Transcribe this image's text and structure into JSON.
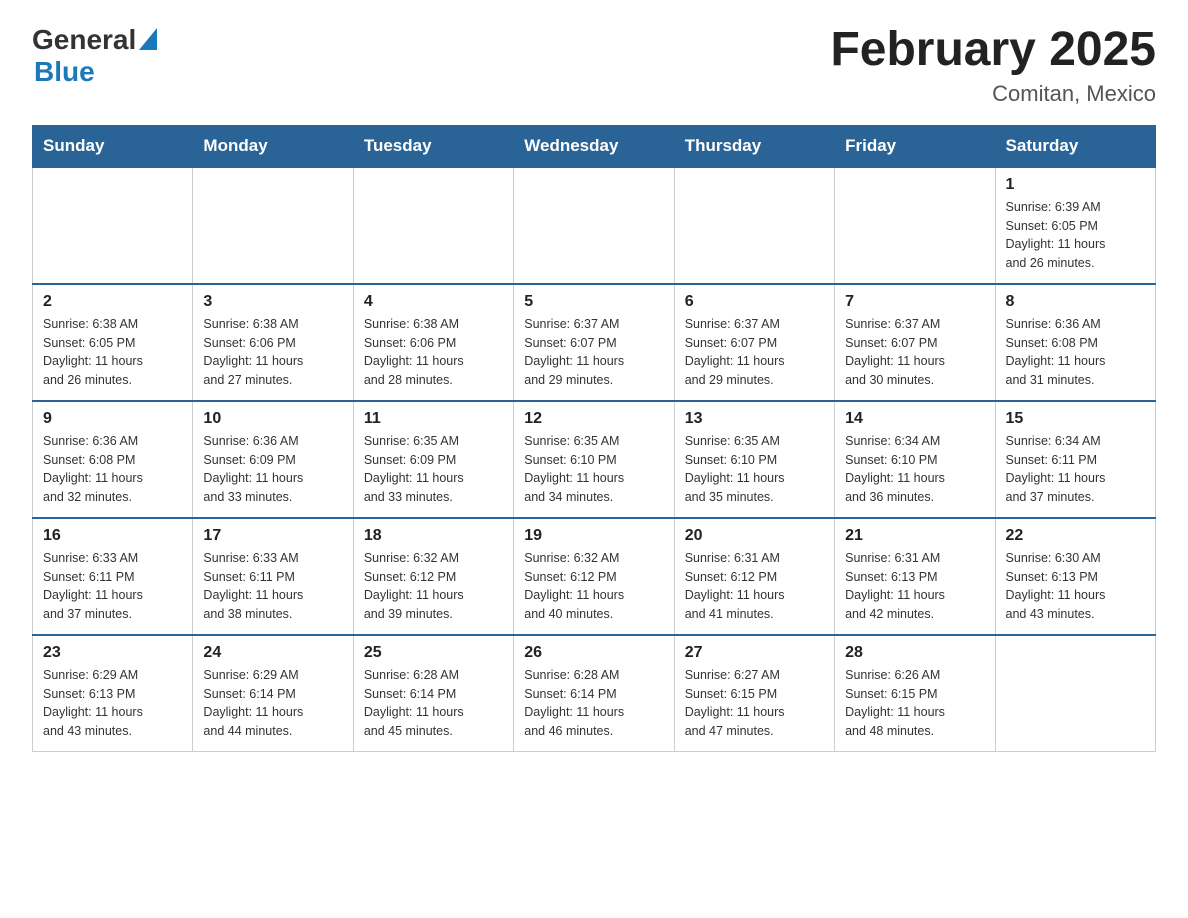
{
  "header": {
    "logo": {
      "general": "General",
      "blue": "Blue",
      "triangle_color": "#1a7ab8"
    },
    "title": "February 2025",
    "location": "Comitan, Mexico"
  },
  "calendar": {
    "weekdays": [
      "Sunday",
      "Monday",
      "Tuesday",
      "Wednesday",
      "Thursday",
      "Friday",
      "Saturday"
    ],
    "weeks": [
      [
        {
          "day": "",
          "info": ""
        },
        {
          "day": "",
          "info": ""
        },
        {
          "day": "",
          "info": ""
        },
        {
          "day": "",
          "info": ""
        },
        {
          "day": "",
          "info": ""
        },
        {
          "day": "",
          "info": ""
        },
        {
          "day": "1",
          "info": "Sunrise: 6:39 AM\nSunset: 6:05 PM\nDaylight: 11 hours\nand 26 minutes."
        }
      ],
      [
        {
          "day": "2",
          "info": "Sunrise: 6:38 AM\nSunset: 6:05 PM\nDaylight: 11 hours\nand 26 minutes."
        },
        {
          "day": "3",
          "info": "Sunrise: 6:38 AM\nSunset: 6:06 PM\nDaylight: 11 hours\nand 27 minutes."
        },
        {
          "day": "4",
          "info": "Sunrise: 6:38 AM\nSunset: 6:06 PM\nDaylight: 11 hours\nand 28 minutes."
        },
        {
          "day": "5",
          "info": "Sunrise: 6:37 AM\nSunset: 6:07 PM\nDaylight: 11 hours\nand 29 minutes."
        },
        {
          "day": "6",
          "info": "Sunrise: 6:37 AM\nSunset: 6:07 PM\nDaylight: 11 hours\nand 29 minutes."
        },
        {
          "day": "7",
          "info": "Sunrise: 6:37 AM\nSunset: 6:07 PM\nDaylight: 11 hours\nand 30 minutes."
        },
        {
          "day": "8",
          "info": "Sunrise: 6:36 AM\nSunset: 6:08 PM\nDaylight: 11 hours\nand 31 minutes."
        }
      ],
      [
        {
          "day": "9",
          "info": "Sunrise: 6:36 AM\nSunset: 6:08 PM\nDaylight: 11 hours\nand 32 minutes."
        },
        {
          "day": "10",
          "info": "Sunrise: 6:36 AM\nSunset: 6:09 PM\nDaylight: 11 hours\nand 33 minutes."
        },
        {
          "day": "11",
          "info": "Sunrise: 6:35 AM\nSunset: 6:09 PM\nDaylight: 11 hours\nand 33 minutes."
        },
        {
          "day": "12",
          "info": "Sunrise: 6:35 AM\nSunset: 6:10 PM\nDaylight: 11 hours\nand 34 minutes."
        },
        {
          "day": "13",
          "info": "Sunrise: 6:35 AM\nSunset: 6:10 PM\nDaylight: 11 hours\nand 35 minutes."
        },
        {
          "day": "14",
          "info": "Sunrise: 6:34 AM\nSunset: 6:10 PM\nDaylight: 11 hours\nand 36 minutes."
        },
        {
          "day": "15",
          "info": "Sunrise: 6:34 AM\nSunset: 6:11 PM\nDaylight: 11 hours\nand 37 minutes."
        }
      ],
      [
        {
          "day": "16",
          "info": "Sunrise: 6:33 AM\nSunset: 6:11 PM\nDaylight: 11 hours\nand 37 minutes."
        },
        {
          "day": "17",
          "info": "Sunrise: 6:33 AM\nSunset: 6:11 PM\nDaylight: 11 hours\nand 38 minutes."
        },
        {
          "day": "18",
          "info": "Sunrise: 6:32 AM\nSunset: 6:12 PM\nDaylight: 11 hours\nand 39 minutes."
        },
        {
          "day": "19",
          "info": "Sunrise: 6:32 AM\nSunset: 6:12 PM\nDaylight: 11 hours\nand 40 minutes."
        },
        {
          "day": "20",
          "info": "Sunrise: 6:31 AM\nSunset: 6:12 PM\nDaylight: 11 hours\nand 41 minutes."
        },
        {
          "day": "21",
          "info": "Sunrise: 6:31 AM\nSunset: 6:13 PM\nDaylight: 11 hours\nand 42 minutes."
        },
        {
          "day": "22",
          "info": "Sunrise: 6:30 AM\nSunset: 6:13 PM\nDaylight: 11 hours\nand 43 minutes."
        }
      ],
      [
        {
          "day": "23",
          "info": "Sunrise: 6:29 AM\nSunset: 6:13 PM\nDaylight: 11 hours\nand 43 minutes."
        },
        {
          "day": "24",
          "info": "Sunrise: 6:29 AM\nSunset: 6:14 PM\nDaylight: 11 hours\nand 44 minutes."
        },
        {
          "day": "25",
          "info": "Sunrise: 6:28 AM\nSunset: 6:14 PM\nDaylight: 11 hours\nand 45 minutes."
        },
        {
          "day": "26",
          "info": "Sunrise: 6:28 AM\nSunset: 6:14 PM\nDaylight: 11 hours\nand 46 minutes."
        },
        {
          "day": "27",
          "info": "Sunrise: 6:27 AM\nSunset: 6:15 PM\nDaylight: 11 hours\nand 47 minutes."
        },
        {
          "day": "28",
          "info": "Sunrise: 6:26 AM\nSunset: 6:15 PM\nDaylight: 11 hours\nand 48 minutes."
        },
        {
          "day": "",
          "info": ""
        }
      ]
    ]
  }
}
